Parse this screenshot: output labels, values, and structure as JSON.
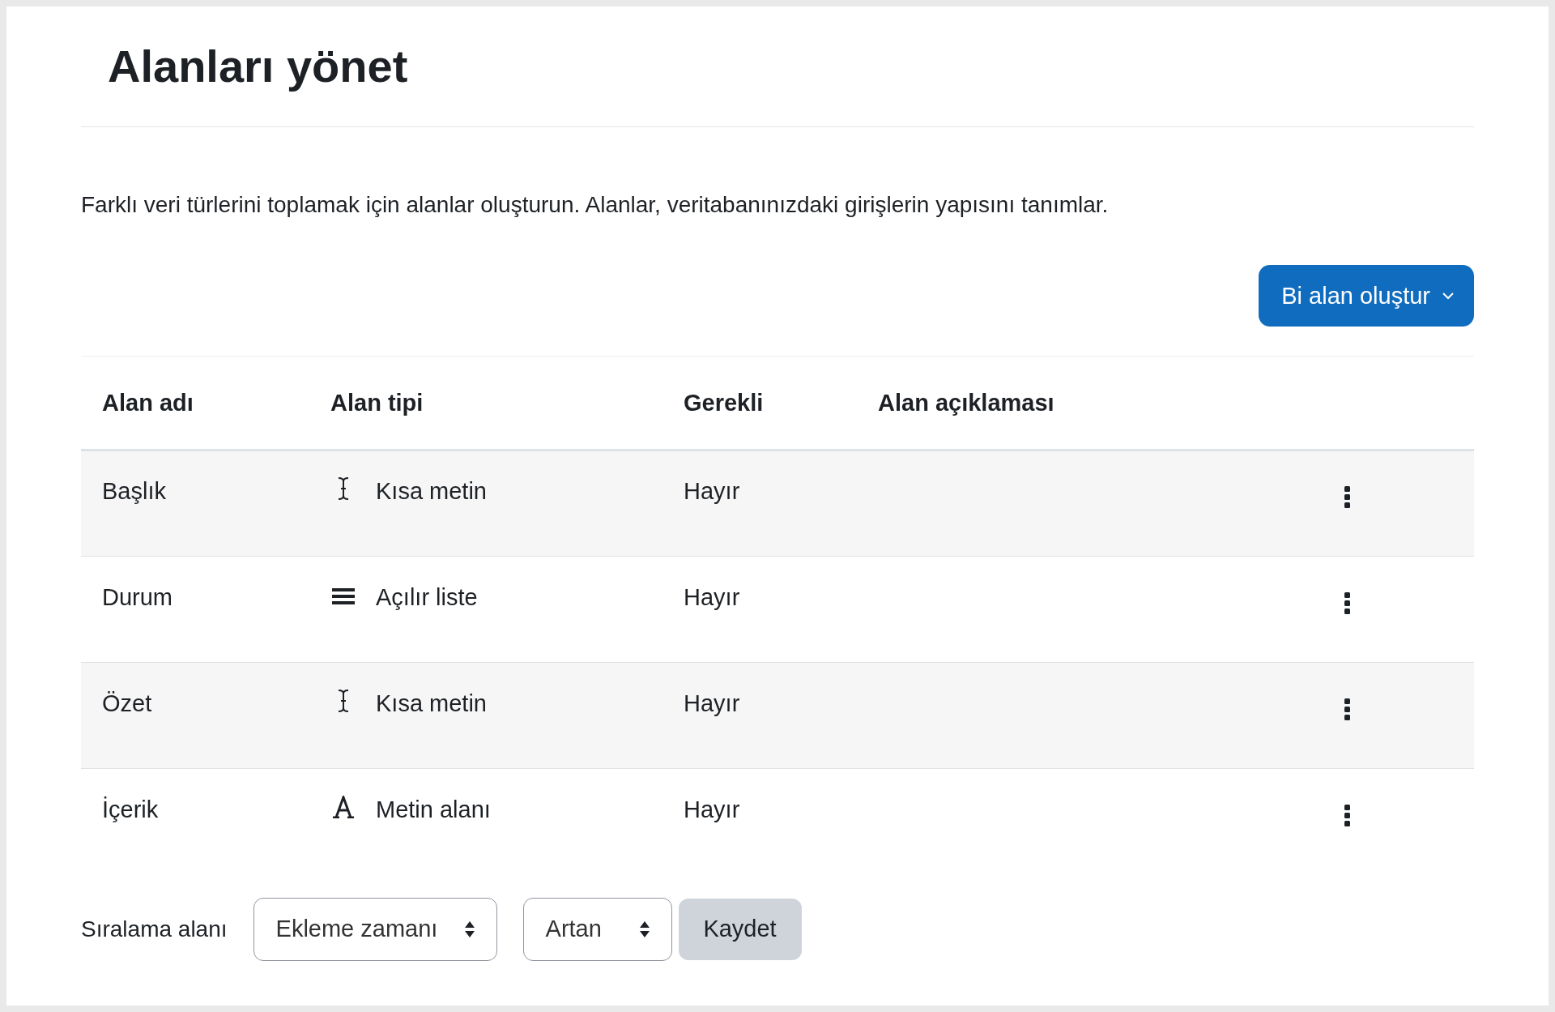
{
  "page": {
    "title": "Alanları yönet",
    "description": "Farklı veri türlerini toplamak için alanlar oluşturun. Alanlar, veritabanınızdaki girişlerin yapısını tanımlar."
  },
  "create_button": {
    "label": "Bi alan oluştur"
  },
  "table": {
    "columns": [
      "Alan adı",
      "Alan tipi",
      "Gerekli",
      "Alan açıklaması"
    ],
    "rows": [
      {
        "name": "Başlık",
        "type": "Kısa metin",
        "kind": "short-text",
        "required": "Hayır"
      },
      {
        "name": "Durum",
        "type": "Açılır liste",
        "kind": "dropdown",
        "required": "Hayır"
      },
      {
        "name": "Özet",
        "type": "Kısa metin",
        "kind": "short-text",
        "required": "Hayır"
      },
      {
        "name": "İçerik",
        "type": "Metin alanı",
        "kind": "textarea",
        "required": "Hayır"
      }
    ]
  },
  "sort": {
    "label": "Sıralama alanı",
    "field": "Ekleme zamanı",
    "order": "Artan",
    "save": "Kaydet"
  }
}
